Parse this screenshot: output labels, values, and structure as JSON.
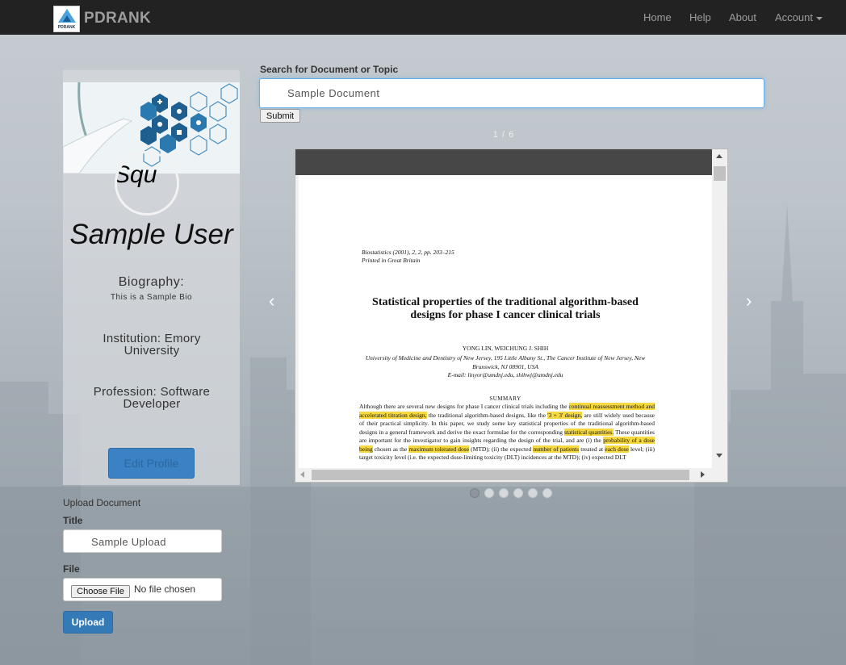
{
  "navbar": {
    "logo_text": "PDRANK",
    "brand": "PDRANK",
    "links": {
      "home": "Home",
      "help": "Help",
      "about": "About",
      "account": "Account"
    }
  },
  "profile": {
    "avatar_alt": "Squ",
    "name": "Sample User",
    "biography_label": "Biography:",
    "biography": "This is a Sample Bio",
    "institution": "Institution: Emory University",
    "profession": "Profession: Software Developer",
    "edit_button": "Edit Profile"
  },
  "upload": {
    "heading": "Upload Document",
    "title_label": "Title",
    "title_value": "Sample Upload",
    "file_label": "File",
    "choose_file": "Choose File",
    "no_file": "No file chosen",
    "upload_button": "Upload"
  },
  "search": {
    "label": "Search for Document or Topic",
    "value": "Sample Document",
    "submit": "Submit"
  },
  "carousel": {
    "counter": "1 / 6",
    "prev": "‹",
    "next": "›",
    "active_index": 0,
    "dot_count": 6
  },
  "document": {
    "journal_line1": "Biostatistics (2001), 2, 2, pp. 203–215",
    "journal_line2": "Printed in Great Britain",
    "title": "Statistical properties of the traditional algorithm-based designs for phase I cancer clinical trials",
    "authors": "YONG LIN, WEICHUNG J. SHIH",
    "affiliation": "University of Medicine and Dentistry of New Jersey, 195 Little Albany St., The Cancer Institute of New Jersey, New Brunswick, NJ 08901, USA",
    "email": "E-mail: linyor@umdnj.edu, shihwj@umdnj.edu",
    "summary_heading": "SUMMARY",
    "abstract": {
      "t1": "Although there are several new designs for phase I cancer clinical trials including the ",
      "h1": "continual reassessment method and accelerated titration design,",
      "t2": " the traditional algorithm-based designs, like the ",
      "h2": "'3 + 3' design,",
      "t3": " are still widely used because of their practical simplicity. In this paper, we study some key statistical properties of the traditional algorithm-based designs in a general framework and derive the exact formulae for the corresponding ",
      "h3": "statistical quantities.",
      "t4": " These quantities are important for the investigator to gain insights regarding the design of the trial, and are (i) the ",
      "h4": "probability of a dose being",
      "t5": " chosen as the ",
      "h5": "maximum tolerated dose",
      "t6": " (MTD); (ii) the expected ",
      "h6": "number of patients",
      "t7": " treated at ",
      "h7": "each dose",
      "t8": " level; (iii) target toxicity level (i.e. the expected dose-limiting toxicity (DLT) incidences at the MTD); (iv) expected DLT"
    }
  }
}
